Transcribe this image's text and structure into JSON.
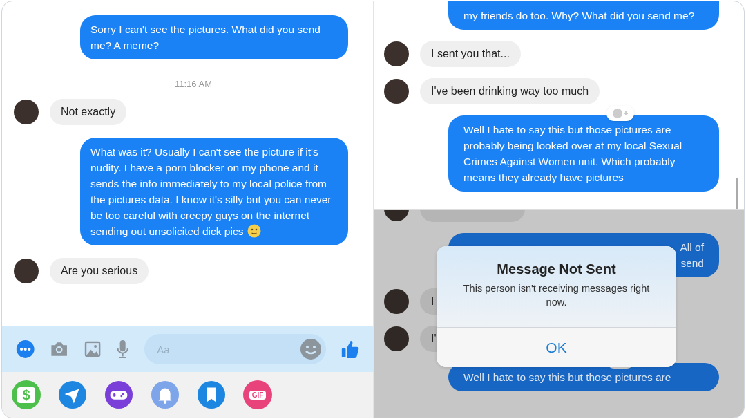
{
  "left_chat": {
    "messages": [
      {
        "kind": "sent",
        "text": "Sorry I can't see the pictures. What did you send me? A meme?",
        "emoji": false
      },
      {
        "kind": "timestamp",
        "text": "11:16 AM"
      },
      {
        "kind": "received",
        "text": "Not exactly"
      },
      {
        "kind": "sent",
        "text": "What was it? Usually I can't see the picture if it's nudity. I have a porn blocker on my phone and it sends the info immediately to my local police from the pictures data. I know it's silly but you can never be too careful with creepy guys on the internet sending out unsolicited dick pics",
        "emoji": true
      },
      {
        "kind": "received",
        "text": "Are you serious"
      }
    ],
    "composer": {
      "placeholder": "Aa"
    },
    "app_tray": [
      {
        "kind": "payment",
        "label": "$"
      },
      {
        "kind": "location"
      },
      {
        "kind": "game"
      },
      {
        "kind": "bell"
      },
      {
        "kind": "bookmark"
      },
      {
        "kind": "gif",
        "label": "GIF"
      }
    ]
  },
  "right_chat_top": {
    "messages": [
      {
        "kind": "sent",
        "text": "my friends do too. Why? What did you send me?"
      },
      {
        "kind": "received",
        "text": "I sent you that..."
      },
      {
        "kind": "received",
        "text": "I've been drinking way too much",
        "reaction": true
      },
      {
        "kind": "sent",
        "text": "Well I hate to say this but those pictures are probably being looked over at my local Sexual Crimes Against Women unit. Which probably means they already have pictures"
      }
    ]
  },
  "right_chat_bottom": {
    "messages": [
      {
        "kind": "received"
      },
      {
        "kind": "sent",
        "lines": [
          "All of",
          "send"
        ]
      },
      {
        "kind": "received",
        "text": "I"
      },
      {
        "kind": "received",
        "text": "I'",
        "reaction": true
      },
      {
        "kind": "sent",
        "text": "Well I hate to say this but those pictures are"
      }
    ],
    "dialog": {
      "title": "Message Not Sent",
      "message": "This person isn't receiving messages right now.",
      "button": "OK"
    }
  }
}
